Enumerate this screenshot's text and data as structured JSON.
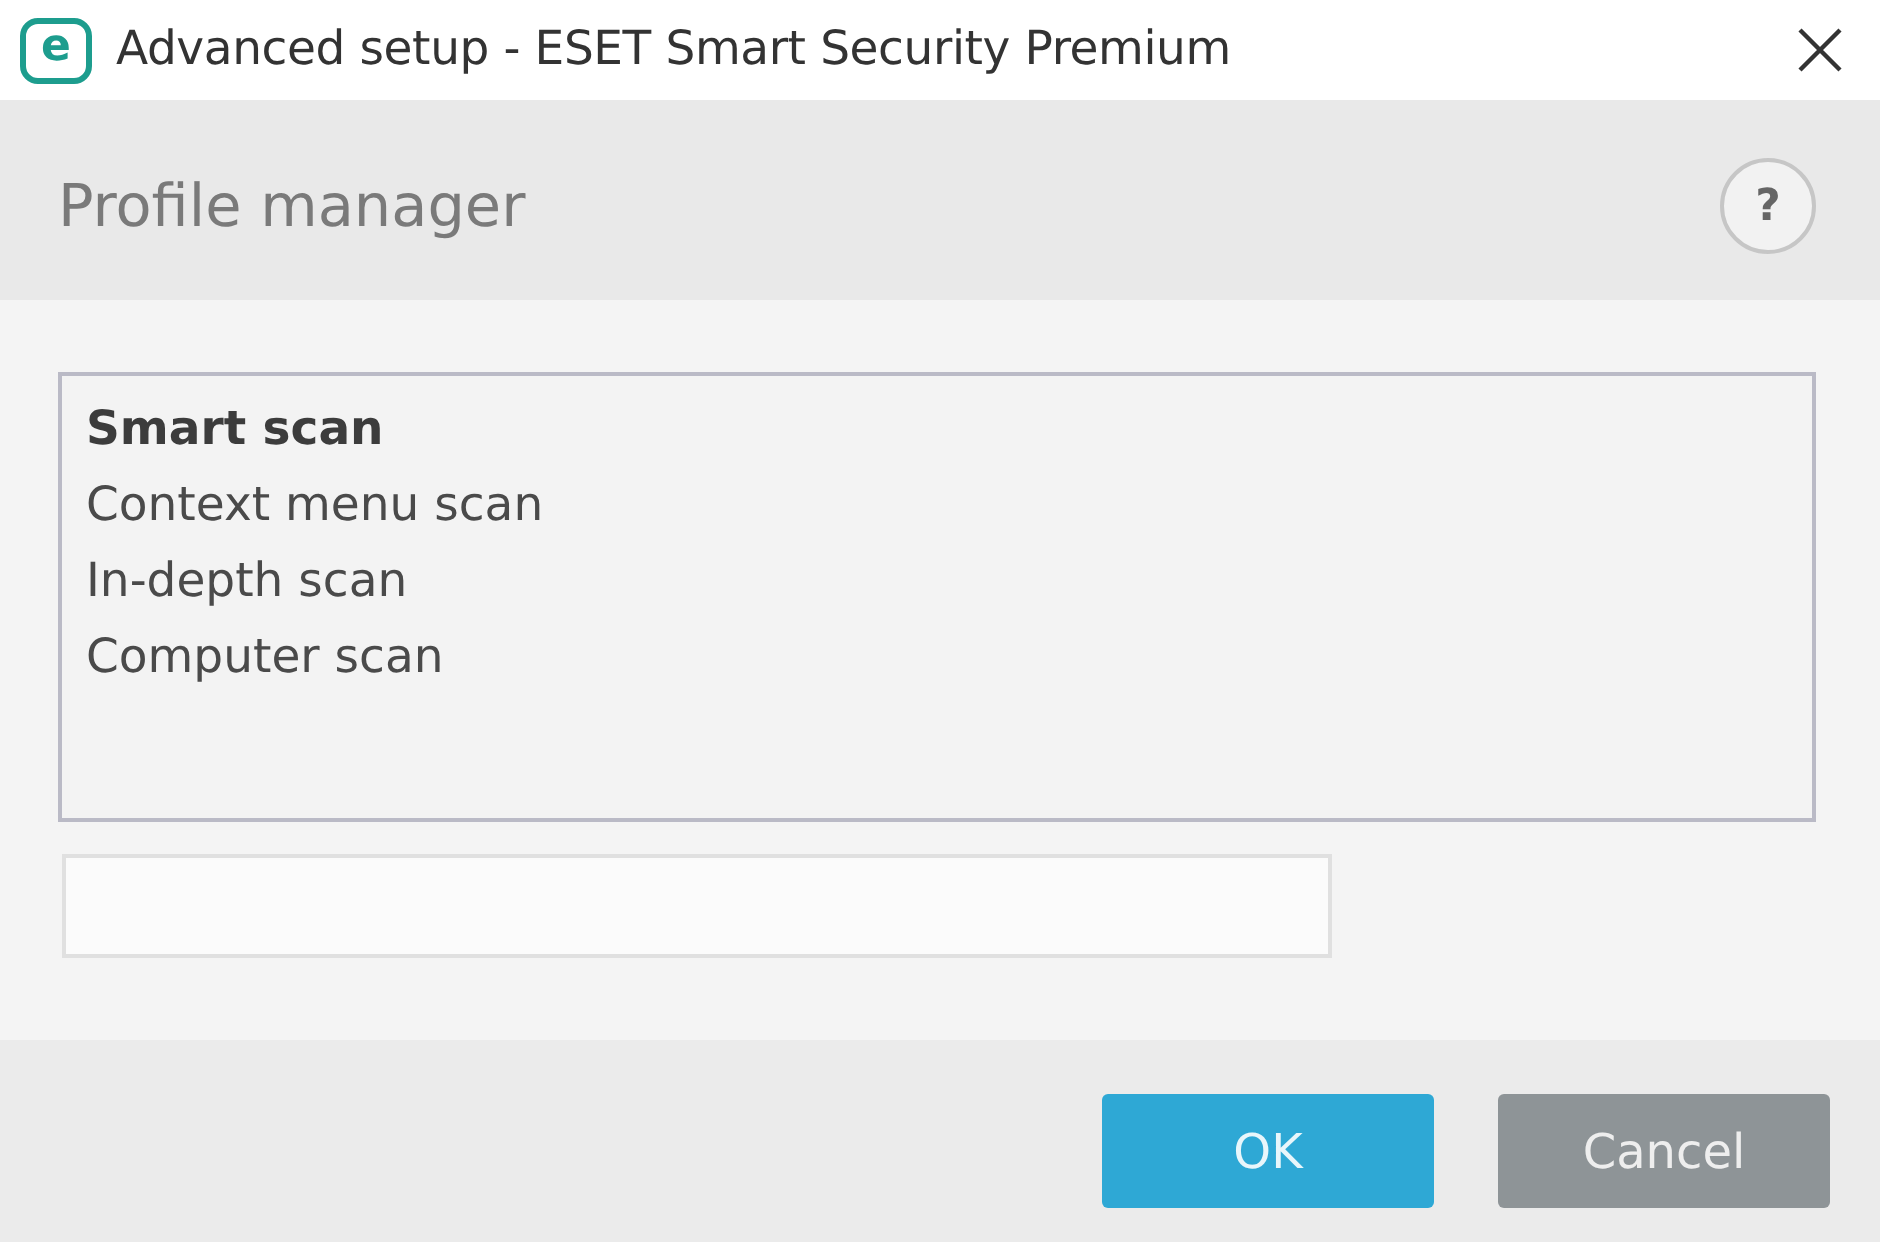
{
  "window": {
    "logo": "e",
    "title": "Advanced setup - ESET Smart Security Premium"
  },
  "header": {
    "title": "Profile manager",
    "help": "?"
  },
  "profiles": [
    {
      "label": "Smart scan",
      "selected": true
    },
    {
      "label": "Context menu scan",
      "selected": false
    },
    {
      "label": "In-depth scan",
      "selected": false
    },
    {
      "label": "Computer scan",
      "selected": false
    }
  ],
  "buttons": [
    {
      "label": "OK",
      "kind": "primary"
    },
    {
      "label": "Cancel",
      "kind": "secondary"
    }
  ]
}
